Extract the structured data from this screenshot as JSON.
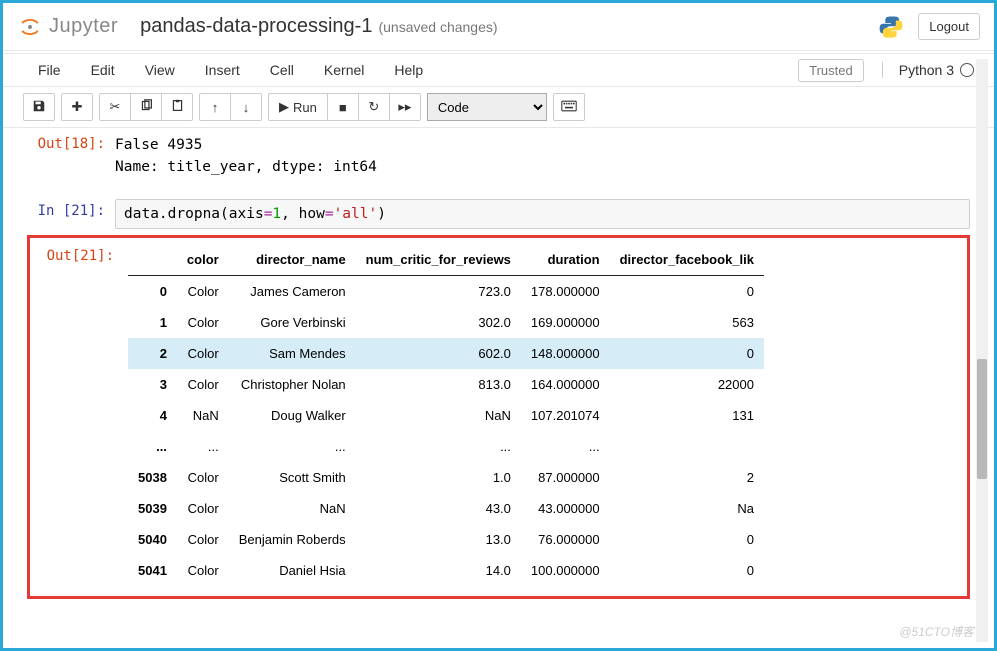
{
  "header": {
    "logo_text": "Jupyter",
    "title": "pandas-data-processing-1",
    "unsaved": "(unsaved changes)",
    "logout": "Logout"
  },
  "menu": {
    "file": "File",
    "edit": "Edit",
    "view": "View",
    "insert": "Insert",
    "cell": "Cell",
    "kernel": "Kernel",
    "help": "Help",
    "trusted": "Trusted",
    "kernel_name": "Python 3"
  },
  "toolbar": {
    "run": "Run",
    "celltype": "Code"
  },
  "cells": {
    "out18_prompt": "Out[18]:",
    "out18_l1": "False    4935",
    "out18_l2": "Name: title_year, dtype: int64",
    "in21_prompt": "In [21]:",
    "in21_code": {
      "obj": "data",
      "method": ".dropna(",
      "arg1": "axis",
      "eq1": "=",
      "num": "1",
      "comma": ", ",
      "arg2": "how",
      "eq2": "=",
      "str": "'all'",
      "close": ")"
    },
    "out21_prompt": "Out[21]:"
  },
  "chart_data": {
    "type": "table",
    "columns": [
      "",
      "color",
      "director_name",
      "num_critic_for_reviews",
      "duration",
      "director_facebook_lik"
    ],
    "rows": [
      [
        "0",
        "Color",
        "James Cameron",
        "723.0",
        "178.000000",
        "0"
      ],
      [
        "1",
        "Color",
        "Gore Verbinski",
        "302.0",
        "169.000000",
        "563"
      ],
      [
        "2",
        "Color",
        "Sam Mendes",
        "602.0",
        "148.000000",
        "0"
      ],
      [
        "3",
        "Color",
        "Christopher Nolan",
        "813.0",
        "164.000000",
        "22000"
      ],
      [
        "4",
        "NaN",
        "Doug Walker",
        "NaN",
        "107.201074",
        "131"
      ],
      [
        "...",
        "...",
        "...",
        "...",
        "...",
        ""
      ],
      [
        "5038",
        "Color",
        "Scott Smith",
        "1.0",
        "87.000000",
        "2"
      ],
      [
        "5039",
        "Color",
        "NaN",
        "43.0",
        "43.000000",
        "Na"
      ],
      [
        "5040",
        "Color",
        "Benjamin Roberds",
        "13.0",
        "76.000000",
        "0"
      ],
      [
        "5041",
        "Color",
        "Daniel Hsia",
        "14.0",
        "100.000000",
        "0"
      ]
    ],
    "hover_row_index": 2
  },
  "watermark": "@51CTO博客"
}
